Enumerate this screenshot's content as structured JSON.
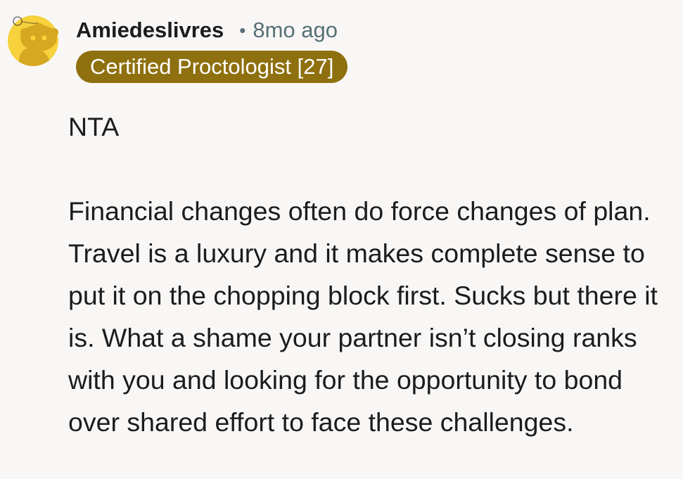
{
  "comment": {
    "username": "Amiedeslivres",
    "separator": "•",
    "timestamp": "8mo ago",
    "flair": "Certified Proctologist [27]",
    "verdict": "NTA",
    "body": "Financial changes often do force changes of plan. Travel is a luxury and it makes complete sense to put it on the chopping block first. Sucks but there it is. What a shame your partner isn’t closing ranks with you and looking for the opportunity to bond over shared effort to face these challenges."
  },
  "avatar": {
    "icon": "snoo-avatar-icon",
    "background_color": "#f7d23c",
    "figure_color": "#d6a821"
  },
  "colors": {
    "flair_background": "#8f700f",
    "flair_text": "#ffffff",
    "meta_text": "#576f76",
    "page_background": "#f9f7f6"
  }
}
